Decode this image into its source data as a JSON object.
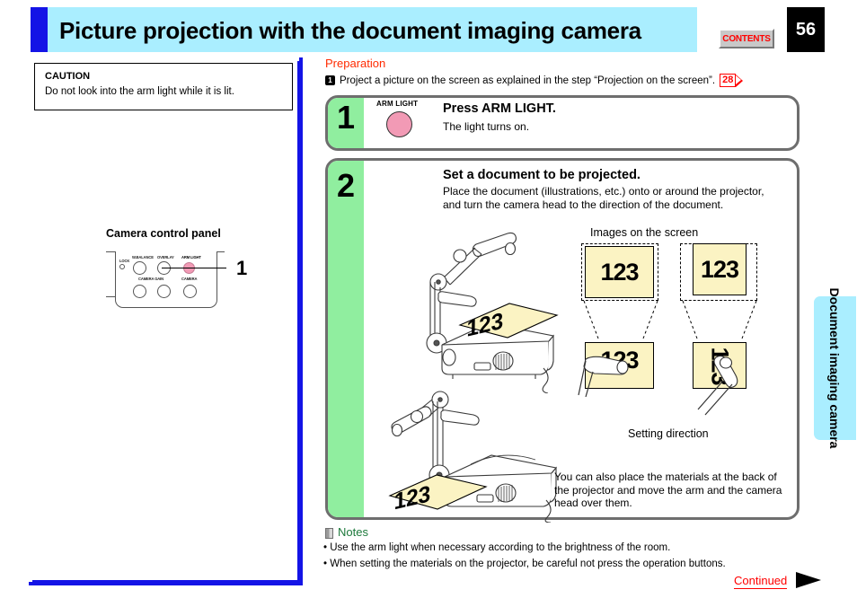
{
  "header": {
    "title": "Picture projection with the document imaging camera",
    "contents_button": "CONTENTS",
    "page_number": "56"
  },
  "side_tab": {
    "label": "Document imaging camera"
  },
  "caution": {
    "title": "CAUTION",
    "text": "Do not look into the arm light while it is lit."
  },
  "camera_control_panel": {
    "title": "Camera control panel",
    "callout_number": "1",
    "buttons": [
      {
        "label": "LOCK",
        "type": "tiny-knob"
      },
      {
        "label": "W.BALANCE",
        "type": "knob"
      },
      {
        "label": "OVERLAY",
        "type": "knob"
      },
      {
        "label": "ARM LIGHT",
        "type": "arm-light-knob",
        "color": "#f29ab5"
      },
      {
        "label": "CAMERA GAIN",
        "type": "knob"
      },
      {
        "label": "CAMERA",
        "type": "knob"
      }
    ]
  },
  "preparation": {
    "title": "Preparation",
    "bullet": "1",
    "text": "Project a picture on the screen as explained in the step “Projection on the screen”.",
    "page_ref": "28"
  },
  "steps": [
    {
      "number": "1",
      "icon_label": "ARM LIGHT",
      "heading": "Press ARM LIGHT.",
      "body": "The light turns on."
    },
    {
      "number": "2",
      "heading": "Set a document to be projected.",
      "body": "Place the document (illustrations, etc.) onto or around the projector, and turn the camera head to the direction of the document.",
      "images_caption": "Images on the screen",
      "setting_caption": "Setting direction",
      "bottom_note": "You can also place the materials at the back of the projector and move the arm and the camera head over them.",
      "document_text": "123"
    }
  ],
  "notes": {
    "title": "Notes",
    "items": [
      "• Use the arm light when necessary according to the brightness of the room.",
      "• When setting the materials on the projector, be careful not press the operation buttons."
    ]
  },
  "footer": {
    "continued": "Continued"
  },
  "colors": {
    "header_bg": "#aaeeff",
    "header_accent": "#1414e6",
    "step_num_bg": "#90ee9f",
    "document_fill": "#fbf3c3",
    "arm_light": "#f29ab5",
    "red": "#ff0000",
    "notes_green": "#1e7a3c"
  }
}
